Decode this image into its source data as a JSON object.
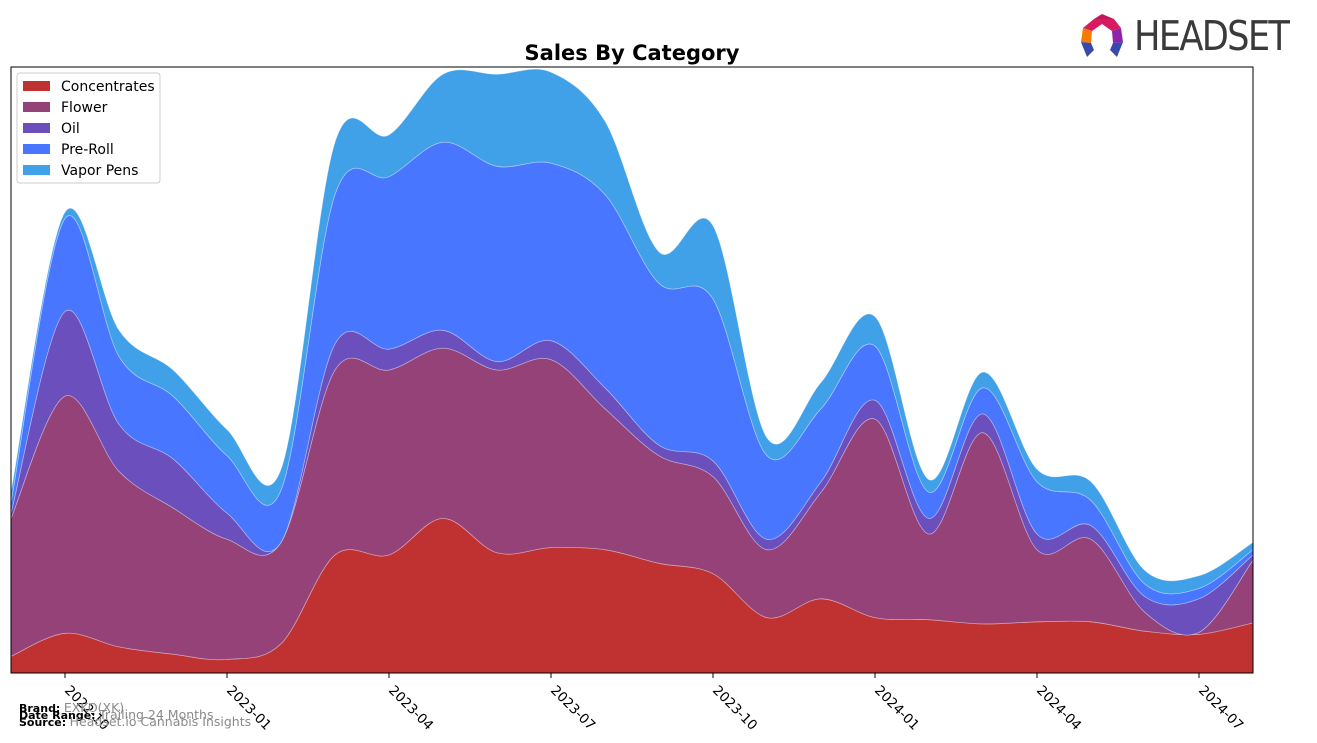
{
  "header": {
    "logo_text": "HEADSET"
  },
  "footer": {
    "brand_label": "Brand:",
    "brand_value": "EXKO(XK)",
    "date_range_label": "Date Range:",
    "date_range_value": "Trailing 24 Months",
    "source_label": "Source:",
    "source_value": "Headset.io Cannabis Insights"
  },
  "colors": {
    "Concentrates": "#c03232",
    "Flower": "#954278",
    "Oil": "#6a4fbd",
    "Pre-Roll": "#4876fe",
    "Vapor Pens": "#40a0e8"
  },
  "chart_data": {
    "type": "area",
    "stacked": true,
    "title": "Sales By Category",
    "xlabel": "",
    "ylabel": "",
    "y_ticks_visible": false,
    "grid": false,
    "legend_position": "top-left",
    "x": [
      "2022-09",
      "2022-10",
      "2022-11",
      "2022-12",
      "2023-01",
      "2023-02",
      "2023-03",
      "2023-04",
      "2023-05",
      "2023-06",
      "2023-07",
      "2023-08",
      "2023-09",
      "2023-10",
      "2023-11",
      "2023-12",
      "2024-01",
      "2024-02",
      "2024-03",
      "2024-04",
      "2024-05",
      "2024-06",
      "2024-07",
      "2024-08"
    ],
    "x_tick_labels": [
      "2022-10",
      "2023-01",
      "2023-04",
      "2023-07",
      "2023-10",
      "2024-01",
      "2024-04",
      "2024-07"
    ],
    "series": [
      {
        "name": "Concentrates",
        "values": [
          16,
          38,
          25,
          18,
          13,
          28,
          113,
          113,
          148,
          115,
          120,
          118,
          105,
          95,
          53,
          71,
          53,
          51,
          47,
          49,
          49,
          40,
          37,
          48
        ]
      },
      {
        "name": "Flower",
        "values": [
          132,
          227,
          168,
          140,
          115,
          97,
          177,
          177,
          163,
          175,
          180,
          135,
          103,
          93,
          65,
          102,
          190,
          82,
          183,
          69,
          79,
          18,
          2,
          60
        ]
      },
      {
        "name": "Oil",
        "values": [
          5,
          81,
          45,
          47,
          25,
          0,
          25,
          20,
          17,
          8,
          18,
          20,
          10,
          15,
          10,
          10,
          18,
          15,
          18,
          15,
          13,
          15,
          32,
          5
        ]
      },
      {
        "name": "Pre-Roll",
        "values": [
          10,
          89,
          65,
          60,
          55,
          50,
          143,
          165,
          180,
          187,
          170,
          185,
          155,
          155,
          80,
          70,
          52,
          25,
          25,
          50,
          24,
          12,
          10,
          5
        ]
      },
      {
        "name": "Vapor Pens",
        "values": [
          10,
          6,
          25,
          25,
          25,
          20,
          50,
          40,
          65,
          88,
          87,
          70,
          30,
          70,
          17,
          25,
          28,
          12,
          15,
          12,
          18,
          13,
          12,
          7
        ]
      }
    ],
    "y_range": [
      0,
      580
    ]
  }
}
